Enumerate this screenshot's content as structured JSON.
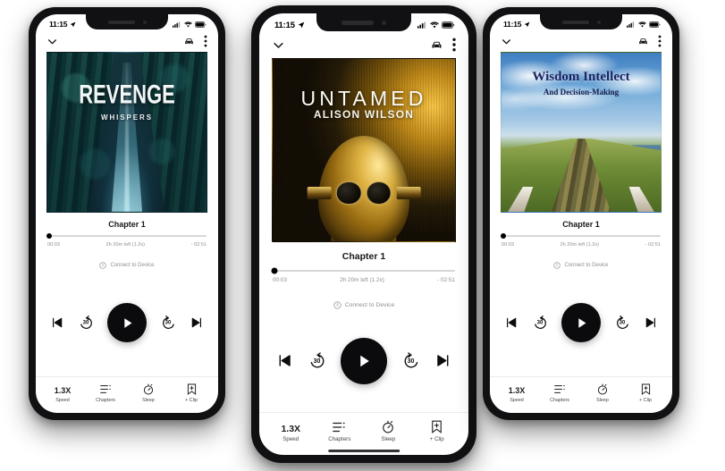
{
  "app": {
    "status_bar": {
      "time": "11:15",
      "location_icon": "location-arrow-icon",
      "signal_icon": "cellular-signal-icon",
      "wifi_icon": "wifi-icon",
      "battery_icon": "battery-icon"
    },
    "app_bar": {
      "collapse_icon": "chevron-down-icon",
      "car_mode_icon": "car-icon",
      "overflow_icon": "more-vertical-icon"
    },
    "chapter_label": "Chapter 1",
    "progress": {
      "elapsed": "00:03",
      "remaining_info": "2h 20m left (1.2x)",
      "remaining": "- 02:51",
      "percent": 1
    },
    "connect": {
      "icon": "cast-device-icon",
      "label": "Connect to Device"
    },
    "transport": {
      "previous_icon": "skip-previous-icon",
      "rewind_icon": "rewind-30-icon",
      "rewind_seconds": "30",
      "play_icon": "play-icon",
      "forward_icon": "forward-30-icon",
      "forward_seconds": "30",
      "next_icon": "skip-next-icon"
    },
    "bottom_bar": [
      {
        "key": "speed",
        "value": "1.3X",
        "label": "Speed",
        "icon": "speed-icon"
      },
      {
        "key": "chapters",
        "value": "",
        "label": "Chapters",
        "icon": "chapters-list-icon"
      },
      {
        "key": "sleep",
        "value": "",
        "label": "Sleep",
        "icon": "sleep-timer-icon"
      },
      {
        "key": "clip",
        "value": "",
        "label": "+ Clip",
        "icon": "add-clip-icon"
      }
    ]
  },
  "phones": [
    {
      "id": "left",
      "cover": {
        "art_name": "revenge-whispers-cover",
        "title": "REVENGE",
        "subtitle": "WHISPERS",
        "palette": {
          "primary": "#12303a",
          "accent": "#7ed6ec"
        }
      }
    },
    {
      "id": "center",
      "cover": {
        "art_name": "untamed-cover",
        "title": "UNTAMED",
        "subtitle": "ALISON WILSON",
        "palette": {
          "primary": "#120c03",
          "accent": "#f6c445"
        }
      }
    },
    {
      "id": "right",
      "cover": {
        "art_name": "wisdom-intellect-cover",
        "title": "Wisdom Intellect",
        "subtitle": "And Decision-Making",
        "palette": {
          "primary": "#6fa8d8",
          "accent": "#1a2360"
        }
      }
    }
  ]
}
